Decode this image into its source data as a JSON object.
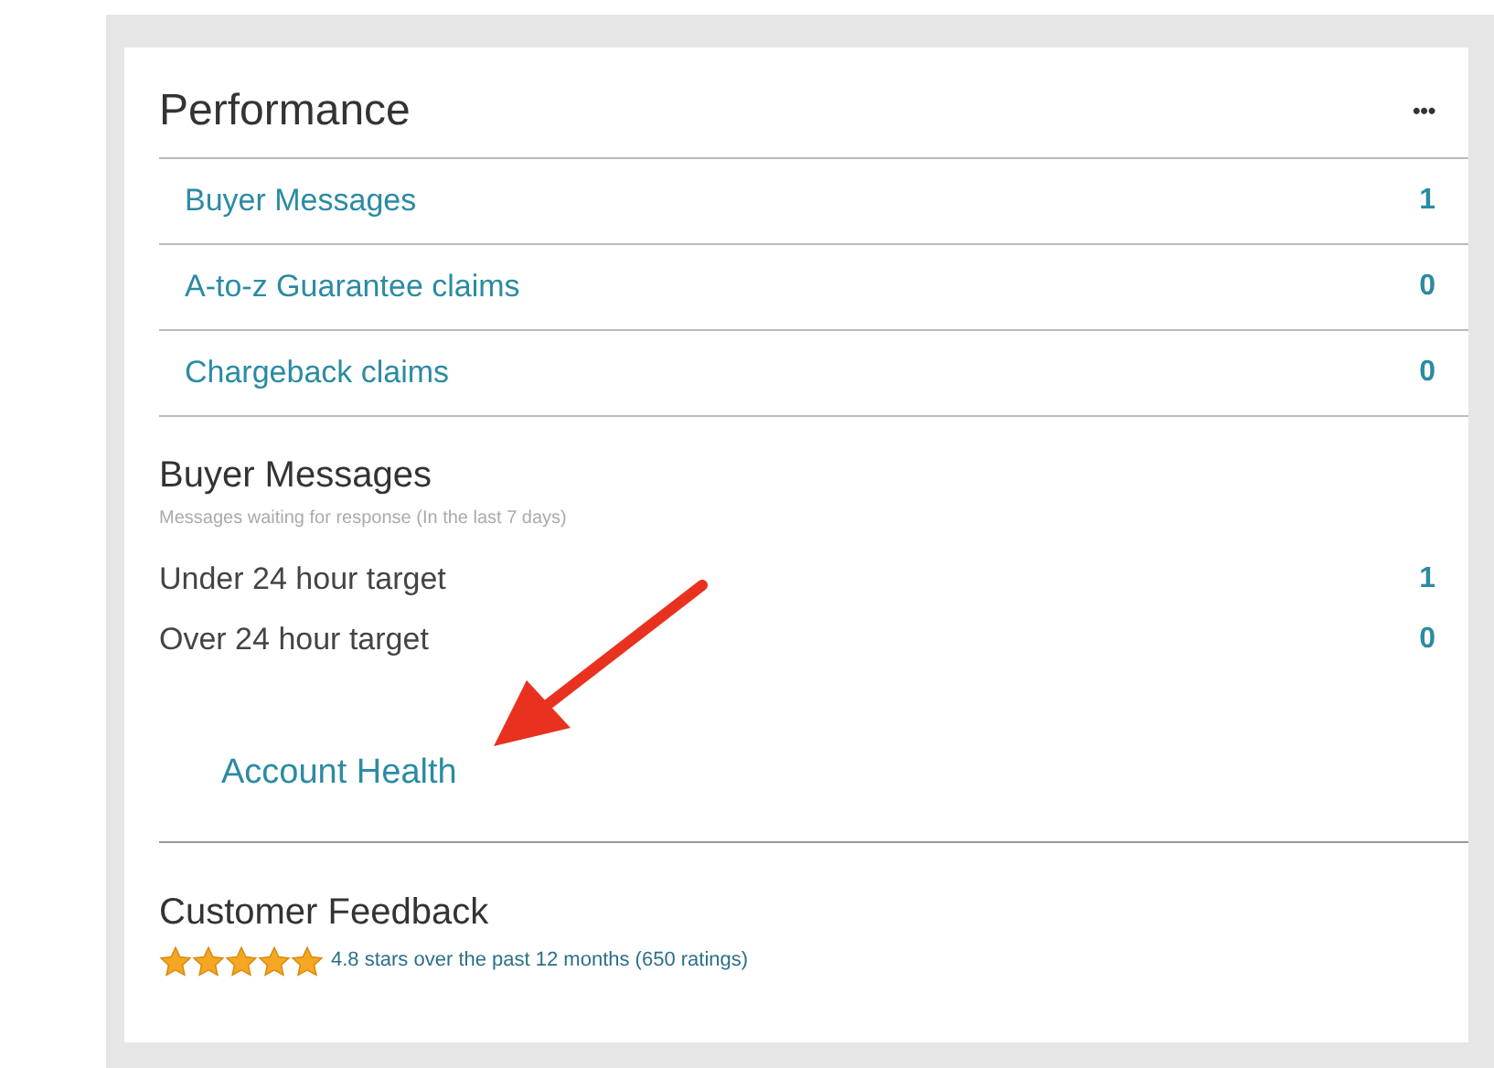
{
  "card": {
    "title": "Performance",
    "menu": "•••"
  },
  "metrics": [
    {
      "label": "Buyer Messages",
      "count": "1"
    },
    {
      "label": "A-to-z Guarantee claims",
      "count": "0"
    },
    {
      "label": "Chargeback claims",
      "count": "0"
    }
  ],
  "buyer_messages": {
    "title": "Buyer Messages",
    "subtitle": "Messages waiting for response (In the last 7 days)",
    "rows": [
      {
        "label": "Under 24 hour target",
        "count": "1"
      },
      {
        "label": "Over 24 hour target",
        "count": "0"
      }
    ]
  },
  "account_health_link": "Account Health",
  "customer_feedback": {
    "title": "Customer Feedback",
    "stars": 5,
    "summary": "4.8 stars over the past 12 months (650 ratings)"
  }
}
